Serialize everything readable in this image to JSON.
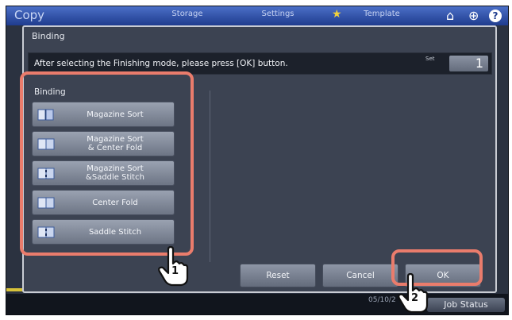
{
  "app_bar": {
    "title": "Copy",
    "tabs": [
      {
        "label": "Storage"
      },
      {
        "label": "Settings"
      },
      {
        "label": "Template",
        "icon": "star-icon"
      }
    ],
    "icons": [
      "home-icon",
      "globe-icon",
      "help-icon"
    ]
  },
  "dialog": {
    "title": "Binding",
    "message": "After selecting the Finishing mode, please press [OK] button.",
    "set_label": "Set",
    "set_value": "1",
    "group_label": "Binding",
    "options": [
      {
        "label": "Magazine Sort",
        "icon": "magazine-sort-icon"
      },
      {
        "label": "Magazine Sort\n& Center Fold",
        "icon": "center-fold-icon"
      },
      {
        "label": "Magazine Sort\n&Saddle Stitch",
        "icon": "saddle-stitch-icon"
      },
      {
        "label": "Center Fold",
        "icon": "center-fold-icon"
      },
      {
        "label": "Saddle Stitch",
        "icon": "saddle-stitch-icon"
      }
    ],
    "buttons": {
      "reset": "Reset",
      "cancel": "Cancel",
      "ok": "OK"
    }
  },
  "status_bar": {
    "date_fragment": "05/10/2",
    "job_status": "Job Status"
  },
  "callouts": {
    "one": "1",
    "two": "2"
  },
  "colors": {
    "highlight": "#ea7c6c",
    "dialog_bg": "#3c4352",
    "topbar": "#2f52aa"
  }
}
